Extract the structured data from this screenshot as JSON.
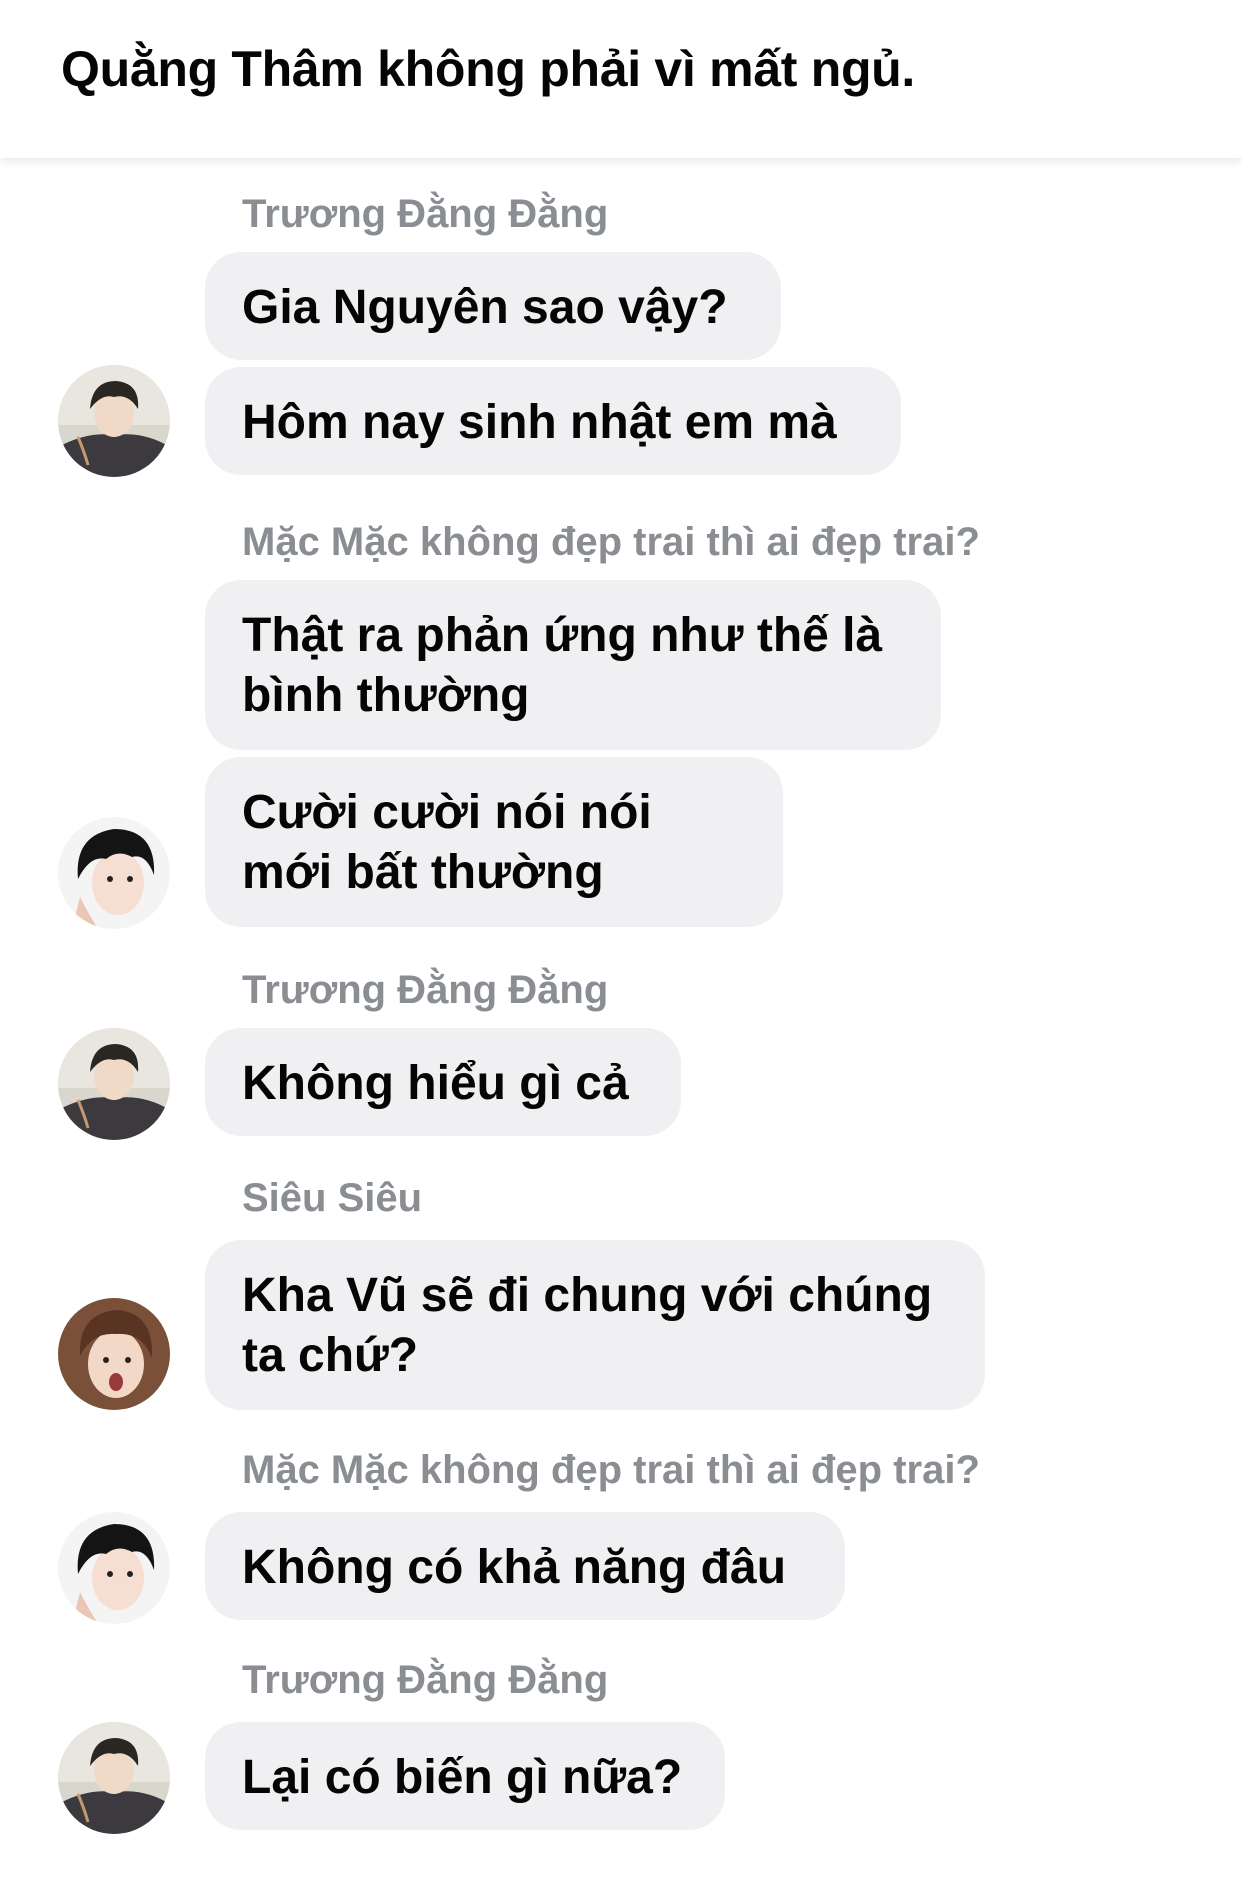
{
  "header": {
    "title": "Quằng Thâm không phải vì mất ngủ."
  },
  "messages": {
    "m1": {
      "sender": "Trương Đằng Đằng",
      "lines": [
        "Gia Nguyên sao vậy?",
        "Hôm nay sinh nhật em mà"
      ]
    },
    "m2": {
      "sender": "Mặc Mặc không đẹp trai thì ai đẹp trai?",
      "lines": [
        "Thật ra phản ứng như thế là bình thường",
        "Cười cười nói nói mới bất thường"
      ]
    },
    "m3": {
      "sender": "Trương Đằng Đằng",
      "lines": [
        "Không hiểu gì cả"
      ]
    },
    "m4": {
      "sender": "Siêu Siêu",
      "lines": [
        "Kha Vũ sẽ đi chung với chúng ta chứ?"
      ]
    },
    "m5": {
      "sender": "Mặc Mặc không đẹp trai thì ai đẹp trai?",
      "lines": [
        "Không có khả năng đâu"
      ]
    },
    "m6": {
      "sender": "Trương Đằng Đằng",
      "lines": [
        "Lại có biến gì nữa?"
      ]
    }
  }
}
